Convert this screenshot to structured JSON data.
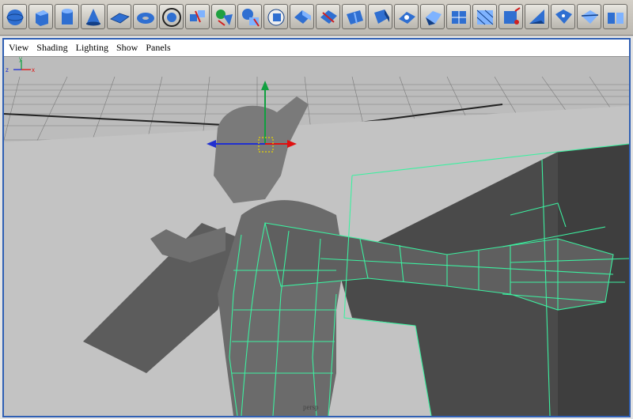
{
  "shelf": {
    "tools": [
      {
        "icon": "poly-sphere-icon"
      },
      {
        "icon": "poly-cube-icon"
      },
      {
        "icon": "poly-cylinder-icon"
      },
      {
        "icon": "poly-cone-icon"
      },
      {
        "icon": "poly-plane-icon"
      },
      {
        "icon": "poly-torus-icon"
      },
      {
        "icon": "select-tool-icon"
      },
      {
        "icon": "combine-icon"
      },
      {
        "icon": "separate-icon"
      },
      {
        "icon": "smooth-icon"
      },
      {
        "icon": "boolean-icon"
      },
      {
        "icon": "extrude-face-icon"
      },
      {
        "icon": "split-polygon-icon"
      },
      {
        "icon": "extrude-edge-icon"
      },
      {
        "icon": "bevel-icon"
      },
      {
        "icon": "duplicate-face-icon"
      },
      {
        "icon": "merge-vertices-icon"
      },
      {
        "icon": "subdivide-icon"
      },
      {
        "icon": "triangulate-icon"
      },
      {
        "icon": "append-polygon-icon"
      },
      {
        "icon": "wedge-face-icon"
      },
      {
        "icon": "poke-face-icon"
      },
      {
        "icon": "cut-faces-icon"
      },
      {
        "icon": "mirror-icon"
      }
    ],
    "colors": {
      "icon_fill": "#2f6fd1",
      "icon_light": "#7fb3ff",
      "icon_dark": "#123f86"
    }
  },
  "panel_menu": {
    "items": [
      "View",
      "Shading",
      "Lighting",
      "Show",
      "Panels"
    ]
  },
  "viewport": {
    "camera": "persp",
    "axis": {
      "z": "z",
      "x": "x",
      "y": "y"
    },
    "colors": {
      "background": "#bdbdbd",
      "grid": "#6f6f6f",
      "wireframe": "#3cf0a0",
      "model": "#6a6a6a",
      "manip_x": "#e01010",
      "manip_y": "#10a040",
      "manip_z": "#2030d0"
    }
  }
}
